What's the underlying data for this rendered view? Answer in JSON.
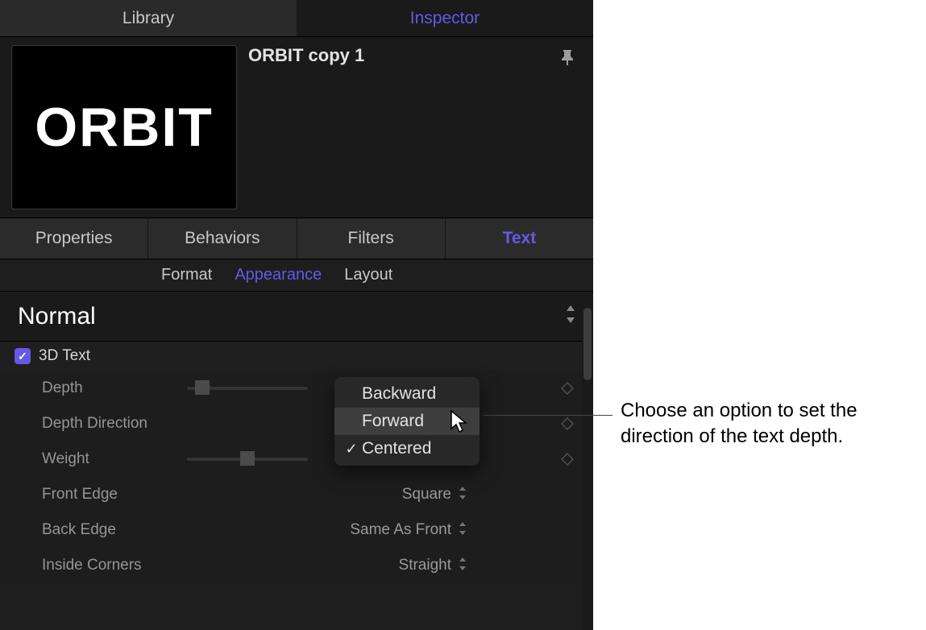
{
  "topTabs": {
    "library": "Library",
    "inspector": "Inspector"
  },
  "preview": {
    "thumbText": "ORBIT",
    "title": "ORBIT copy 1"
  },
  "sectionTabs": {
    "properties": "Properties",
    "behaviors": "Behaviors",
    "filters": "Filters",
    "text": "Text"
  },
  "subtabs": {
    "format": "Format",
    "appearance": "Appearance",
    "layout": "Layout"
  },
  "styleSelect": "Normal",
  "group": {
    "checkbox": true,
    "label": "3D Text"
  },
  "params": {
    "depth": {
      "label": "Depth"
    },
    "depthDirection": {
      "label": "Depth Direction"
    },
    "weight": {
      "label": "Weight",
      "value": "0"
    },
    "frontEdge": {
      "label": "Front Edge",
      "value": "Square"
    },
    "backEdge": {
      "label": "Back Edge",
      "value": "Same As Front"
    },
    "insideCorners": {
      "label": "Inside Corners",
      "value": "Straight"
    }
  },
  "popup": {
    "items": [
      "Backward",
      "Forward",
      "Centered"
    ],
    "highlighted": "Forward",
    "checked": "Centered"
  },
  "callout": "Choose an option to set the direction of the text depth."
}
